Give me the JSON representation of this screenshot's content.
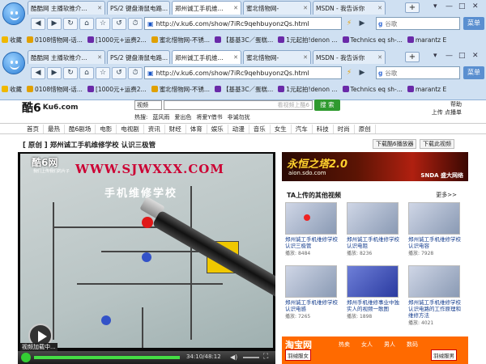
{
  "browser": {
    "tabs": [
      {
        "label": "酷酷网 主播软推介..."
      },
      {
        "label": "PS/2 键盘滑鼠电路..."
      },
      {
        "label": "郑州诚工手机维..."
      },
      {
        "label": "蜜北惜物网-"
      },
      {
        "label": "MSDN - 我告诉你"
      }
    ],
    "active_tab": 2,
    "new_tab": "+",
    "url": "http://v.ku6.com/show/7iRc9qehbuyonzQs.html",
    "search_placeholder": "谷歌",
    "menu_label": "菜单",
    "nav": [
      "◀",
      "▶",
      "↻",
      "⌂",
      "☆",
      "↺",
      "⏱",
      "◔"
    ],
    "bookmarks": [
      {
        "label": "收藏",
        "color": "#f0b800"
      },
      {
        "label": "0108惜物网-话...",
        "color": "#e0a000"
      },
      {
        "label": "[1000元+运费2...",
        "color": "#6a2aa8"
      },
      {
        "label": "蜜北惜物网-不锈...",
        "color": "#e0a000"
      },
      {
        "label": "【基基3C／蛋糕...",
        "color": "#6a2aa8"
      },
      {
        "label": "1元起拍!denon ...",
        "color": "#6a2aa8"
      },
      {
        "label": "Technics eq sh-...",
        "color": "#6a2aa8"
      },
      {
        "label": "marantz E",
        "color": "#6a2aa8"
      }
    ]
  },
  "site": {
    "logo": "酷6",
    "logo_domain": "Ku6.com",
    "logo_sub": "酷6",
    "search_type": "视频",
    "search_placeholder": "看视频上酷6",
    "search_button": "搜 索",
    "hot_label": "热搜:",
    "hot": [
      "蓝风雨",
      "爱出色",
      "将爱Y借书",
      "非诚勿扰"
    ],
    "top_right": [
      "帮助",
      "上传",
      "点播单"
    ],
    "categories": [
      "首页",
      "最热",
      "酷6剧场",
      "电影",
      "电视剧",
      "资讯",
      "财经",
      "体育",
      "娱乐",
      "动漫",
      "音乐",
      "女生",
      "汽车",
      "科技",
      "时尚",
      "原创"
    ],
    "video_title": "[ 原创 ] 郑州诚工手机维修学校 认识三极管",
    "video_buttons": [
      "下载酷6播放器",
      "下载此视频"
    ],
    "player": {
      "watermark": "WWW.SJWXXX.COM",
      "watermark2": "手机维修学校",
      "brand": "酷6网",
      "brand_sub": "我们上传我们的片子",
      "loading": "视频加载中...",
      "time": "34:10/48:12"
    },
    "ad": {
      "title": "永恒之塔2.0",
      "sub": "aion.sdo.com",
      "corp": "SNDA 盛大网络"
    },
    "related_title": "TA上传的其他视频",
    "more": "更多>>",
    "videos": [
      {
        "title": "郑州诚工手机维修学校 认识三极管",
        "count_label": "播放:",
        "count": "8484",
        "style": "red"
      },
      {
        "title": "郑州诚工手机维修学校 认识电阻",
        "count_label": "播放:",
        "count": "8236",
        "style": "plain"
      },
      {
        "title": "郑州诚工手机维修学校 认识电容",
        "count_label": "播放:",
        "count": "7928",
        "style": "plain"
      },
      {
        "title": "郑州诚工手机维修学校 认识电感",
        "count_label": "播放:",
        "count": "7265",
        "style": "plain"
      },
      {
        "title": "郑州手机维修事业中独实人的视频一歌图",
        "count_label": "播放:",
        "count": "1898",
        "style": "blue"
      },
      {
        "title": "郑州诚工手机维修学校 认识电路的工作原理和维修方法",
        "count_label": "播放:",
        "count": "4021",
        "style": "plain"
      }
    ],
    "taobao": {
      "logo": "淘宝网",
      "tabs": [
        "热卖",
        "女人",
        "男人",
        "数码"
      ],
      "left_box": "羽绒服女",
      "right_box": "羽绒服男"
    }
  }
}
